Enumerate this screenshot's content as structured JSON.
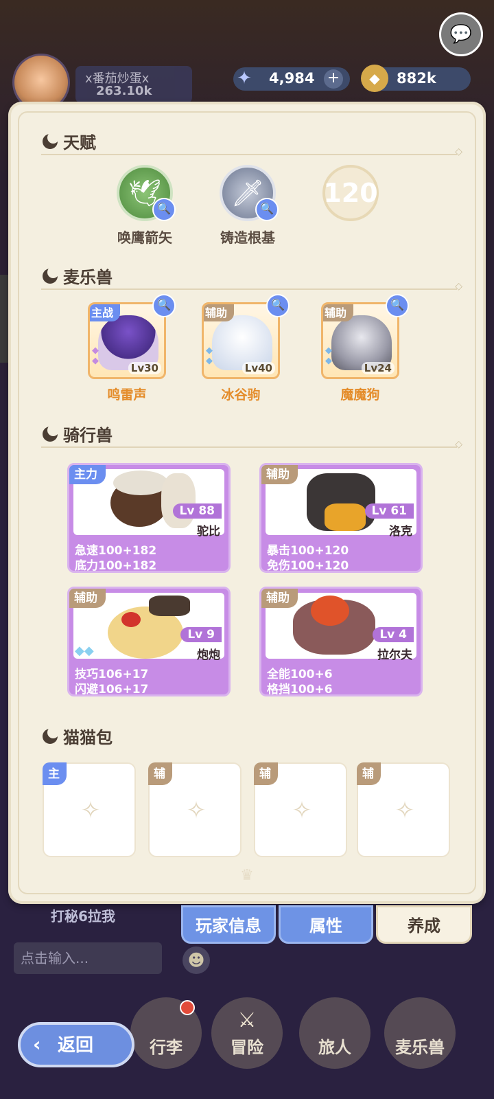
{
  "hud": {
    "player_name": "x番茄炒蛋x",
    "player_power": "263.10k",
    "gems": "4,984",
    "gold": "882k",
    "gem_icon": "star-gem-icon",
    "gold_icon": "coin-icon"
  },
  "sections": {
    "talent": "天赋",
    "pets": "麦乐兽",
    "mounts": "骑行兽",
    "catbag": "猫猫包"
  },
  "talents": [
    {
      "name": "唤鹰箭矢",
      "icon": "eagle-arrow-icon",
      "color": "#5a9a4a"
    },
    {
      "name": "铸造根基",
      "icon": "sword-forge-icon",
      "color": "#7e8aa6"
    },
    {
      "level": "120",
      "icon": "locked-talent-icon"
    }
  ],
  "pets": [
    {
      "tag": "主战",
      "name": "鸣雷声",
      "level": "Lv30",
      "tag_color": "#6b8ef0"
    },
    {
      "tag": "辅助",
      "name": "冰谷驹",
      "level": "Lv40",
      "tag_color": "#b99b7a"
    },
    {
      "tag": "辅助",
      "name": "魔魔狗",
      "level": "Lv24",
      "tag_color": "#b99b7a"
    }
  ],
  "mounts": [
    {
      "tag": "主力",
      "level": "Lv 88",
      "name": "驼比",
      "stat1": "急速100+182",
      "stat2": "底力100+182"
    },
    {
      "tag": "辅助",
      "level": "Lv 61",
      "name": "洛克",
      "stat1": "暴击100+120",
      "stat2": "免伤100+120"
    },
    {
      "tag": "辅助",
      "level": "Lv 9",
      "name": "炮炮",
      "stat1": "技巧106+17",
      "stat2": "闪避106+17"
    },
    {
      "tag": "辅助",
      "level": "Lv 4",
      "name": "拉尔夫",
      "stat1": "全能100+6",
      "stat2": "格挡100+6"
    }
  ],
  "catbag": [
    {
      "tag": "主"
    },
    {
      "tag": "辅"
    },
    {
      "tag": "辅"
    },
    {
      "tag": "辅"
    }
  ],
  "tabs": [
    "玩家信息",
    "属性",
    "养成"
  ],
  "chat": {
    "last_sender": "打秘6拉我",
    "input_placeholder": "点击输入..."
  },
  "nav": {
    "back": "返回",
    "items": [
      "行李",
      "冒险",
      "旅人",
      "麦乐兽"
    ]
  },
  "colors": {
    "panel_bg": "#f4efe0",
    "mount_purple": "#c78ce6",
    "tab_blue": "#6e93e5",
    "main_tag_blue": "#6b8ef0",
    "aux_tag_tan": "#b99b7a"
  }
}
